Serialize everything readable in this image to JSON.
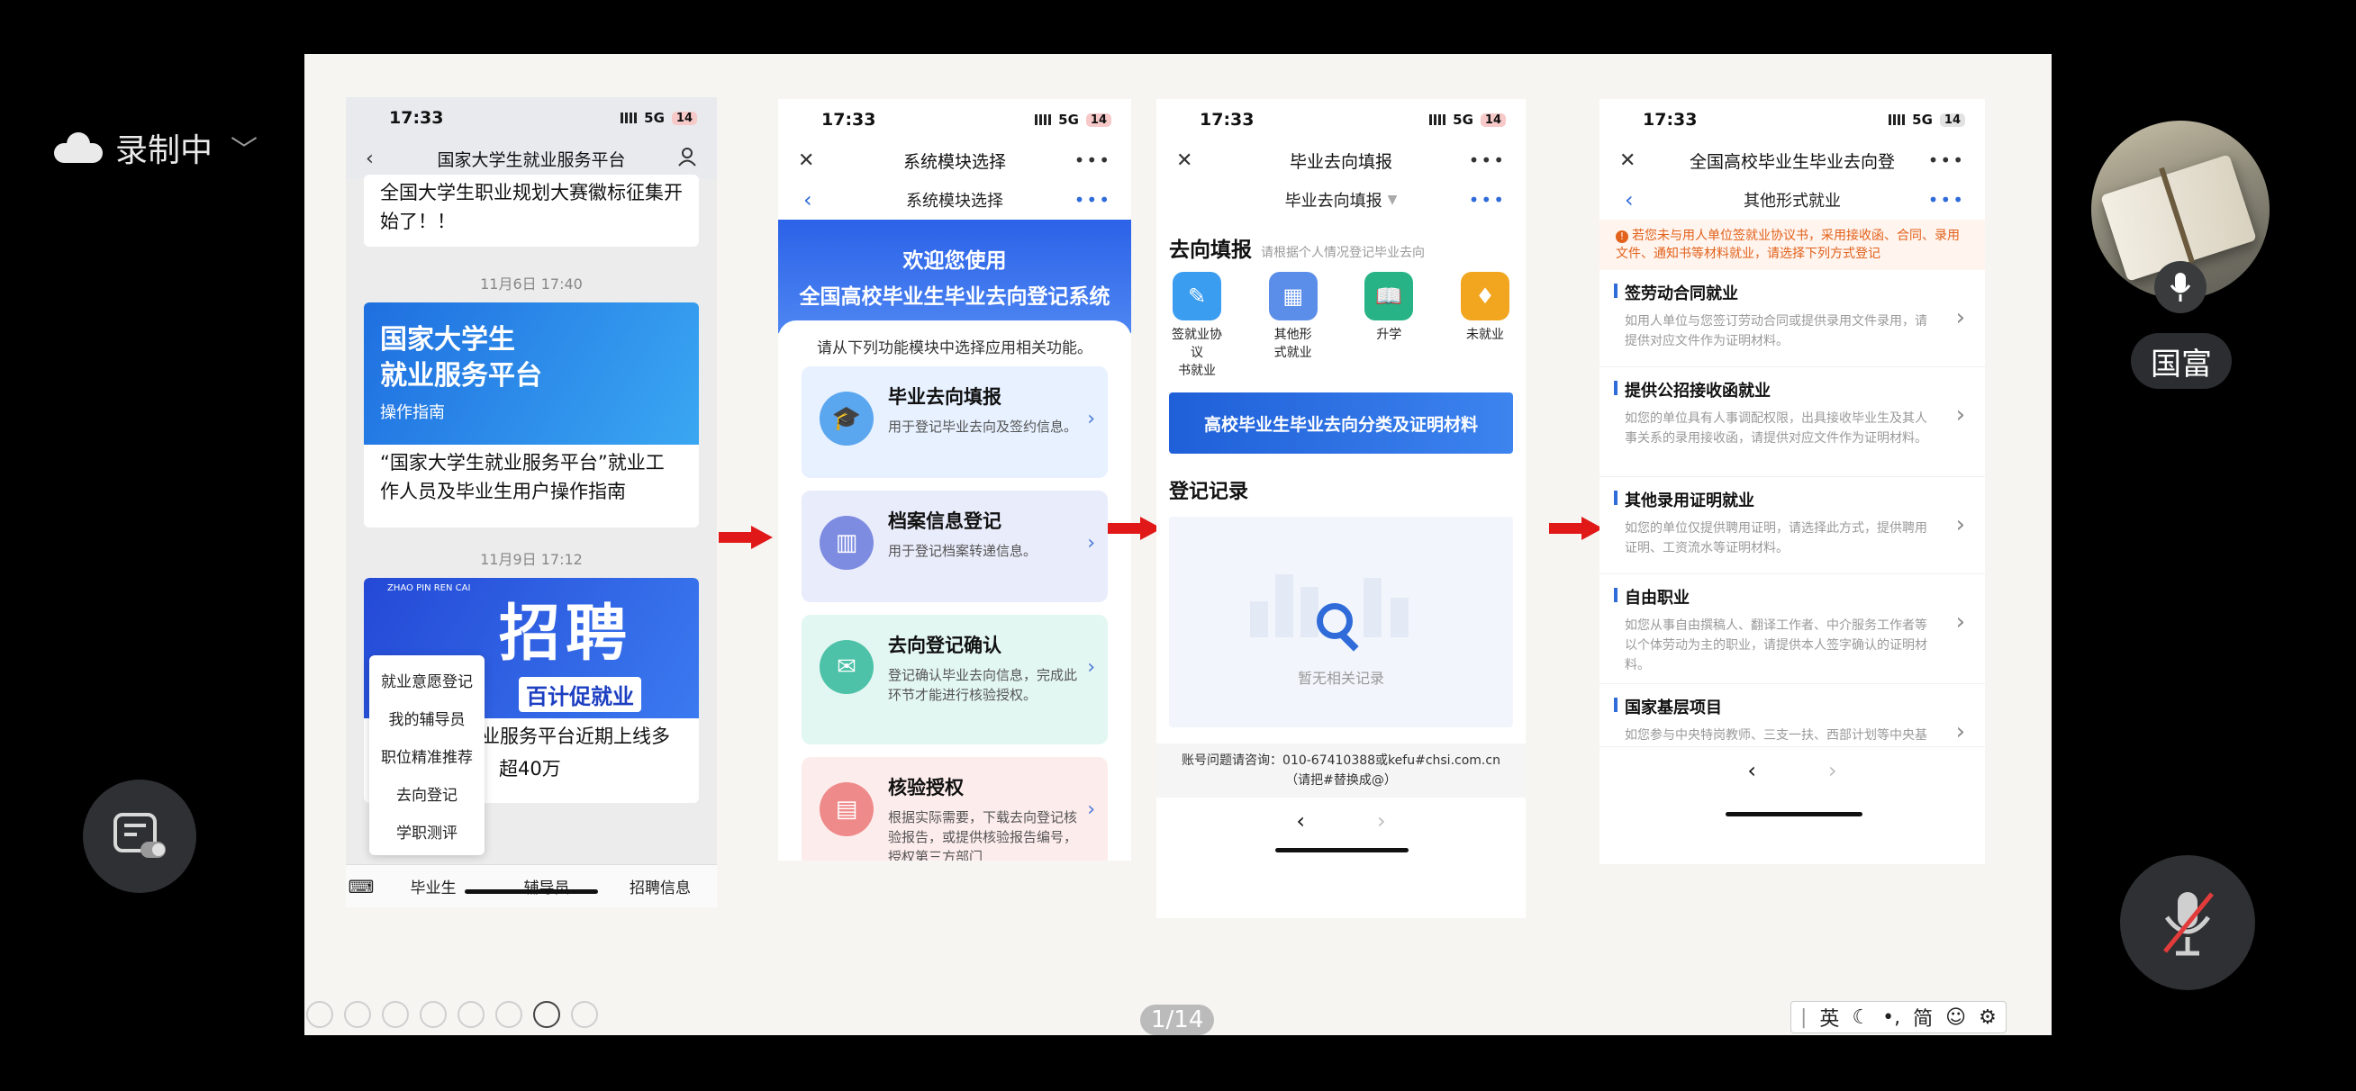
{
  "meeting": {
    "recording_label": "录制中",
    "participant_name": "国富",
    "page_indicator": "1/14",
    "ime": {
      "lang": "英",
      "script": "简"
    }
  },
  "phone1": {
    "time": "17:33",
    "network": "5G",
    "battery": "14",
    "title": "国家大学生就业服务平台",
    "card1_text": "全国大学生职业规划大赛徽标征集开始了！！",
    "ts1": "11月6日 17:40",
    "banner1_line1": "国家大学生",
    "banner1_line2": "就业服务平台",
    "banner1_sub": "操作指南",
    "card2_text": "“国家大学生就业服务平台”就业工作人员及毕业生用户操作指南",
    "ts2": "11月9日 17:12",
    "banner2_tag": "ZHAO PIN REN CAI",
    "banner2_big": "招聘",
    "banner2_small": "百计促就业",
    "card3_text_a": "业服务平台近期上线多",
    "card3_text_b": "超40万",
    "menu": [
      "就业意愿登记",
      "我的辅导员",
      "职位精准推荐",
      "去向登记",
      "学职测评"
    ],
    "tabs": [
      "毕业生",
      "辅导员",
      "招聘信息"
    ]
  },
  "phone2": {
    "time": "17:33",
    "network": "5G",
    "battery": "14",
    "title": "系统模块选择",
    "subtitle": "系统模块选择",
    "hero_line1": "欢迎您使用",
    "hero_line2": "全国高校毕业生毕业去向登记系统",
    "hint": "请从下列功能模块中选择应用相关功能。",
    "modules": [
      {
        "title": "毕业去向填报",
        "desc": "用于登记毕业去向及签约信息。",
        "color": "#e7f1ff",
        "icon_bg": "#5aa6ef"
      },
      {
        "title": "档案信息登记",
        "desc": "用于登记档案转递信息。",
        "color": "#e9ecfb",
        "icon_bg": "#7d8ce0"
      },
      {
        "title": "去向登记确认",
        "desc": "登记确认毕业去向信息，完成此环节才能进行核验授权。",
        "color": "#e3f7f2",
        "icon_bg": "#4dc2a8"
      },
      {
        "title": "核验授权",
        "desc": "根据实际需要，下载去向登记核验报告，或提供核验报告编号，授权第三方部门",
        "color": "#fdecec",
        "icon_bg": "#ef8a8a"
      }
    ]
  },
  "phone3": {
    "time": "17:33",
    "network": "5G",
    "battery": "14",
    "title": "毕业去向填报",
    "subtitle": "毕业去向填报",
    "section1": "去向填报",
    "section1_hint": "请根据个人情况登记毕业去向",
    "quick": [
      {
        "l1": "签就业协议",
        "l2": "书就业",
        "bg": "#3a9df0"
      },
      {
        "l1": "其他形",
        "l2": "式就业",
        "bg": "#5b8ee8"
      },
      {
        "l1": "升学",
        "l2": "",
        "bg": "#27b386"
      },
      {
        "l1": "未就业",
        "l2": "",
        "bg": "#f2a51f"
      }
    ],
    "banner": "高校毕业生毕业去向分类及证明材料",
    "section2": "登记记录",
    "empty_text": "暂无相关记录",
    "footer1": "账号问题请咨询：010-67410388或kefu#chsi.com.cn",
    "footer2": "（请把#替换成@）"
  },
  "phone4": {
    "time": "17:33",
    "network": "5G",
    "battery": "14",
    "title": "全国高校毕业生毕业去向登",
    "subtitle": "其他形式就业",
    "warning": "若您未与用人单位签就业协议书，采用接收函、合同、录用文件、通知书等材料就业，请选择下列方式登记",
    "items": [
      {
        "title": "签劳动合同就业",
        "desc": "如用人单位与您签订劳动合同或提供录用文件录用，请提供对应文件作为证明材料。"
      },
      {
        "title": "提供公招接收函就业",
        "desc": "如您的单位具有人事调配权限，出具接收毕业生及其人事关系的录用接收函，请提供对应文件作为证明材料。"
      },
      {
        "title": "其他录用证明就业",
        "desc": "如您的单位仅提供聘用证明，请选择此方式，提供聘用证明、工资流水等证明材料。"
      },
      {
        "title": "自由职业",
        "desc": "如您从事自由撰稿人、翻译工作者、中介服务工作者等以个体劳动为主的职业，请提供本人签字确认的证明材料。"
      },
      {
        "title": "国家基层项目",
        "desc": "如您参与中央特岗教师、三支一扶、西部计划等中央基层项目，请提供项目录用文件或"
      }
    ]
  }
}
